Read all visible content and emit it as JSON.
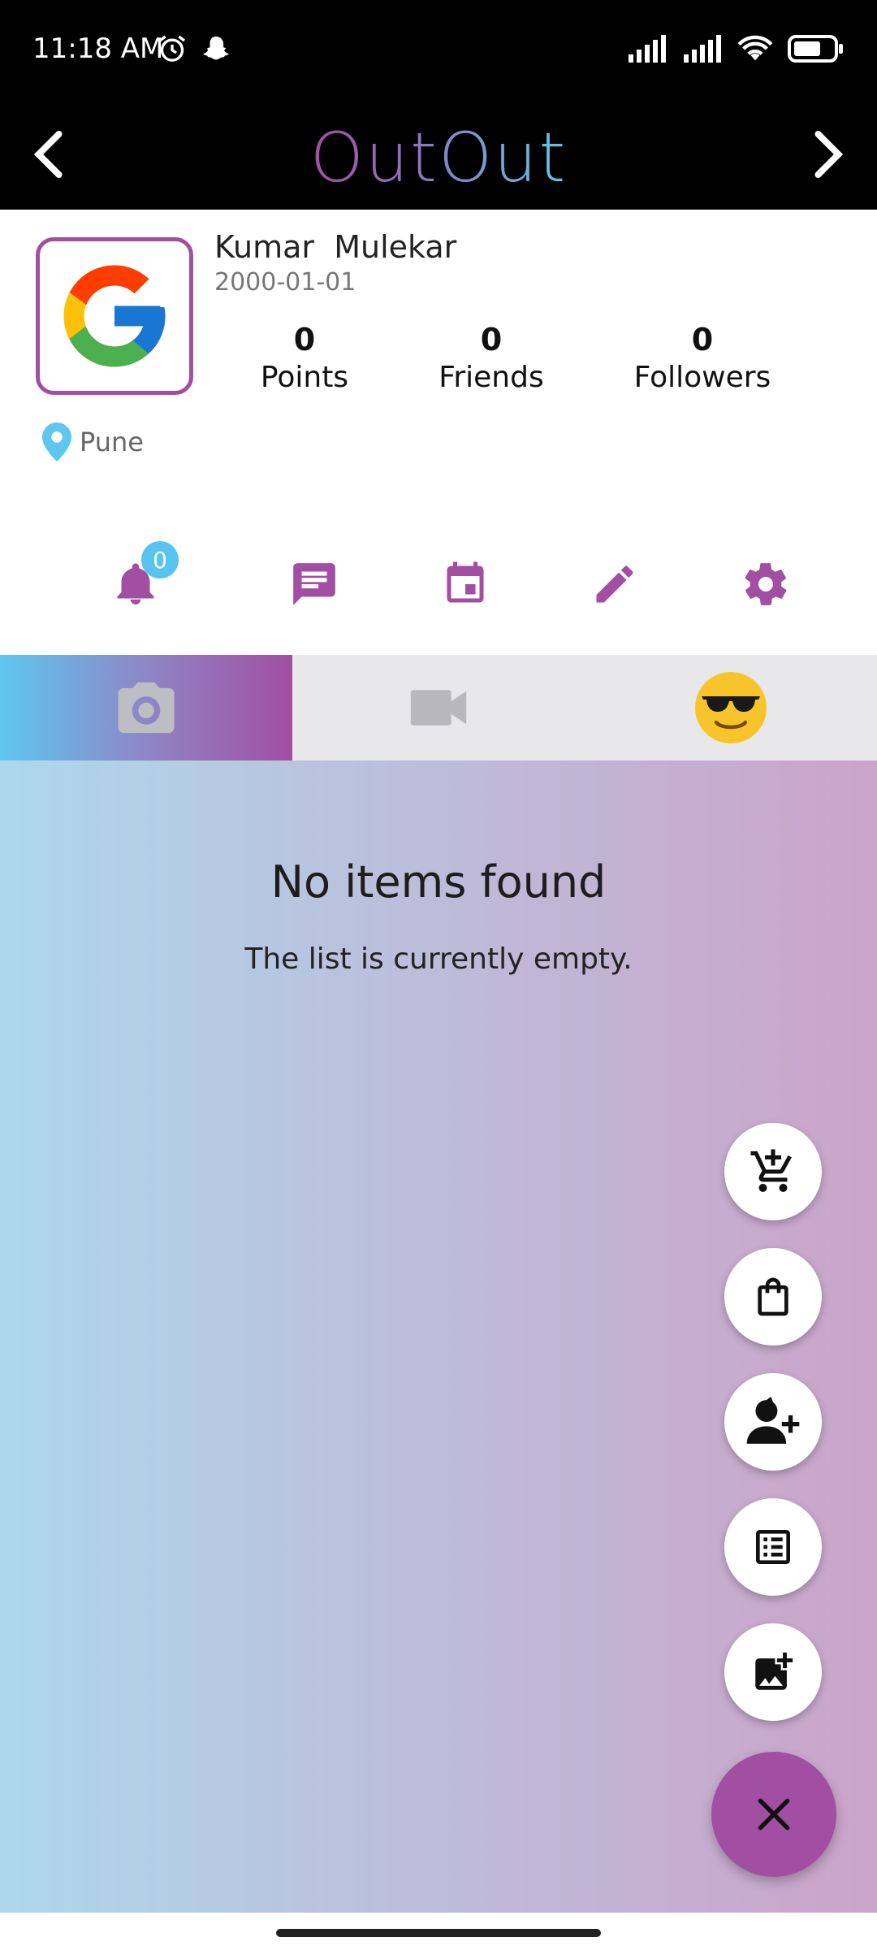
{
  "status_bar": {
    "time": "11:18 AM",
    "icons_left": [
      "alarm-icon",
      "snapchat-icon"
    ],
    "icons_right": [
      "signal-icon",
      "signal-icon",
      "wifi-icon",
      "battery-icon"
    ]
  },
  "header": {
    "logo_text": "OutOut",
    "back_icon": "chevron-left-icon",
    "forward_icon": "chevron-right-icon"
  },
  "profile": {
    "name": "Kumar  Mulekar",
    "dob": "2000-01-01",
    "stats": [
      {
        "value": "0",
        "label": "Points"
      },
      {
        "value": "0",
        "label": "Friends"
      },
      {
        "value": "0",
        "label": "Followers"
      }
    ],
    "location": "Pune",
    "avatar_icon": "google-logo-icon"
  },
  "actions": {
    "notifications_count": "0",
    "icons": [
      "bell-icon",
      "message-icon",
      "calendar-icon",
      "edit-icon",
      "gear-icon"
    ]
  },
  "tabs": [
    {
      "name": "photos",
      "icon": "camera-icon",
      "active": true
    },
    {
      "name": "videos",
      "icon": "video-icon",
      "active": false
    },
    {
      "name": "fun",
      "icon": "sunglasses-emoji-icon",
      "active": false
    }
  ],
  "empty_state": {
    "title": "No items found",
    "subtitle": "The list is currently empty."
  },
  "fab": {
    "mini_actions": [
      "add-to-cart-icon",
      "shopping-bag-icon",
      "add-person-icon",
      "list-icon",
      "add-photo-icon"
    ],
    "main_icon": "close-icon"
  },
  "colors": {
    "accent": "#a24ea3",
    "badge": "#58c3ee"
  }
}
